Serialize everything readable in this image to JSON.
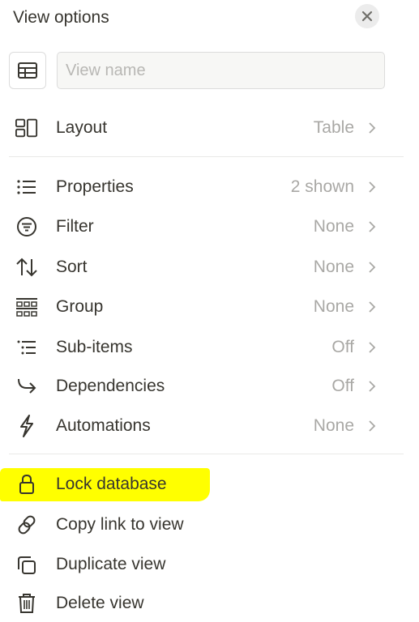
{
  "header": {
    "title": "View options",
    "close_icon": "close-icon"
  },
  "view_name": {
    "icon": "table-icon",
    "placeholder": "View name",
    "value": ""
  },
  "layout": {
    "icon": "layout-icon",
    "label": "Layout",
    "value": "Table"
  },
  "settings": [
    {
      "icon": "list-icon",
      "label": "Properties",
      "value": "2 shown"
    },
    {
      "icon": "filter-icon",
      "label": "Filter",
      "value": "None"
    },
    {
      "icon": "sort-arrows-icon",
      "label": "Sort",
      "value": "None"
    },
    {
      "icon": "group-icon",
      "label": "Group",
      "value": "None"
    },
    {
      "icon": "sub-items-icon",
      "label": "Sub-items",
      "value": "Off"
    },
    {
      "icon": "dependency-arrow-icon",
      "label": "Dependencies",
      "value": "Off"
    },
    {
      "icon": "lightning-icon",
      "label": "Automations",
      "value": "None"
    }
  ],
  "actions": [
    {
      "icon": "lock-icon",
      "label": "Lock database",
      "highlighted": true
    },
    {
      "icon": "link-icon",
      "label": "Copy link to view"
    },
    {
      "icon": "duplicate-icon",
      "label": "Duplicate view"
    },
    {
      "icon": "trash-icon",
      "label": "Delete view"
    }
  ],
  "colors": {
    "text": "#37352f",
    "muted": "#a9a8a5",
    "highlight": "#ffff00",
    "divider": "#e9e9e7"
  }
}
